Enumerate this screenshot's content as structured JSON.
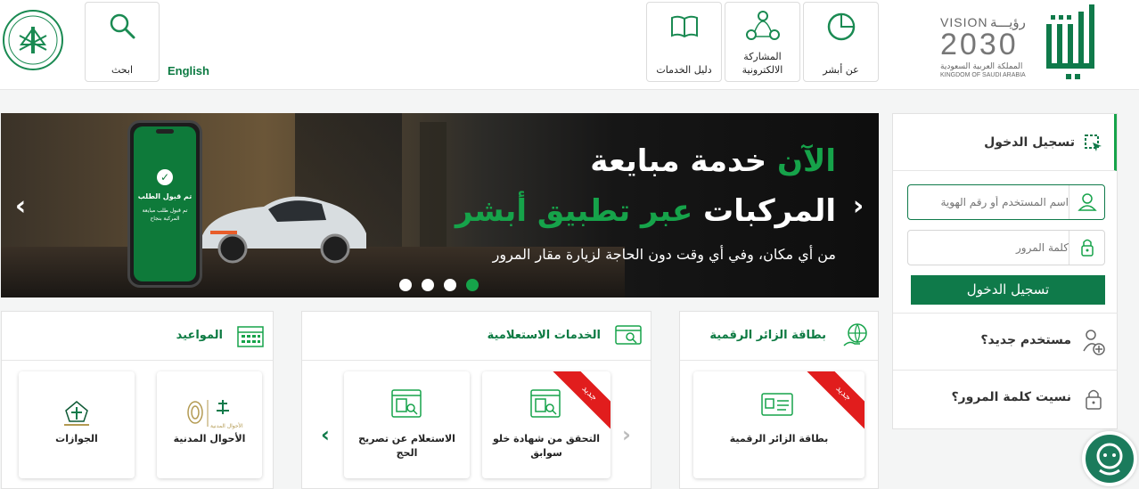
{
  "header": {
    "vision": {
      "top": "VISION",
      "ar_word": "رؤيـــة",
      "year": "2030",
      "kingdom_ar": "المملكة العربية السعودية",
      "kingdom_en": "KINGDOM OF SAUDI ARABIA"
    },
    "logo_alt": "أبشر",
    "tiles": [
      {
        "label": "عن أبشر",
        "icon": "pie-chart-icon"
      },
      {
        "label": "المشاركة\nالالكترونية",
        "icon": "share-network-icon"
      },
      {
        "label": "دليل الخدمات",
        "icon": "open-book-icon"
      }
    ],
    "language": "English",
    "search_label": "ابحث"
  },
  "hero": {
    "line1_green": "الآن",
    "line1_white": "خدمة مبايعة",
    "line2_white": "المركبات",
    "line2_green": "عبر تطبيق أبشر",
    "line3": "من أي مكان، وفي أي وقت دون الحاجة لزيارة مقار المرور",
    "phone_title": "تم قبول الطلب",
    "phone_body": "تم قبول طلب مبايعة المركبة بنجاح",
    "dots": 4,
    "active_dot": 4
  },
  "login": {
    "title": "تسجيل الدخول",
    "username_placeholder": "اسم المستخدم أو رقم الهوية",
    "password_placeholder": "كلمة المرور",
    "submit": "تسجيل الدخول",
    "new_user": "مستخدم جديد؟",
    "forgot": "نسيت كلمة المرور؟"
  },
  "panels": {
    "visitor": {
      "title": "بطاقة الزائر الرقمية",
      "cards": [
        {
          "label": "بطاقة الزائر الرقمية",
          "badge": "جديد"
        }
      ]
    },
    "inquiry": {
      "title": "الخدمات الاستعلامية",
      "cards": [
        {
          "label": "التحقق من شهادة خلو سوابق",
          "badge": "جديد"
        },
        {
          "label": "الاستعلام عن تصريح الحج",
          "badge": ""
        }
      ]
    },
    "appointments": {
      "title": "المواعيد",
      "cards": [
        {
          "label": "الأحوال المدنية",
          "logo_text": "الأحوال المدنية"
        },
        {
          "label": "الجوازات"
        }
      ]
    }
  },
  "colors": {
    "brand_green": "#0f7a4a",
    "accent_green": "#16a34a",
    "badge_red": "#e11d1d"
  }
}
